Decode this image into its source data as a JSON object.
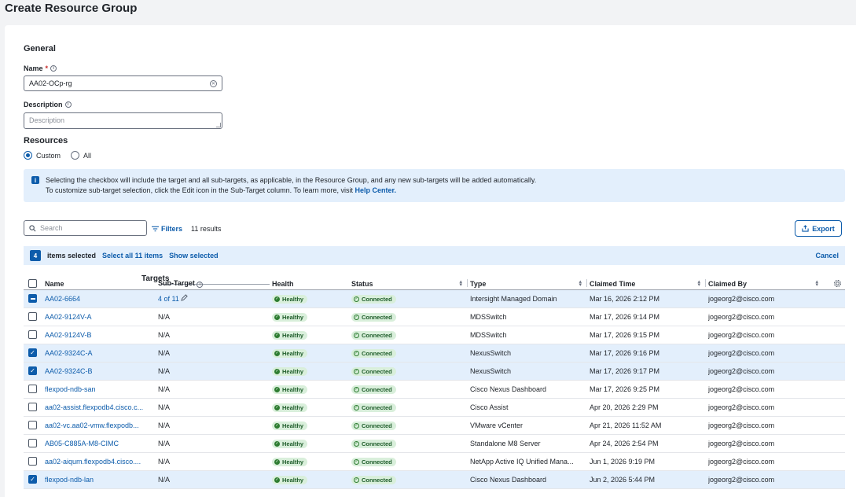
{
  "page_title": "Create Resource Group",
  "general": {
    "title": "General",
    "name_label": "Name",
    "name_required": "*",
    "name_value": "AA02-OCp-rg",
    "description_label": "Description",
    "description_placeholder": "Description"
  },
  "resources": {
    "title": "Resources",
    "options": [
      "Custom",
      "All"
    ],
    "selected": "Custom"
  },
  "banner": {
    "line1": "Selecting the checkbox will include the target and all sub-targets, as applicable, in the Resource Group, and any new sub-targets will be added automatically.",
    "line2": "To customize sub-target selection, click the Edit icon in the Sub-Target column. To learn more, visit ",
    "link": "Help Center."
  },
  "toolbar": {
    "search_placeholder": "Search",
    "filters_label": "Filters",
    "results": "11 results",
    "export_label": "Export"
  },
  "selection": {
    "count": "4",
    "items_selected": "items selected",
    "select_all": "Select all 11 items",
    "show_selected": "Show selected",
    "cancel": "Cancel"
  },
  "table": {
    "group_header": "Targets",
    "columns": {
      "name": "Name",
      "subtarget": "Sub-Target",
      "health": "Health",
      "status": "Status",
      "type": "Type",
      "claimed_time": "Claimed Time",
      "claimed_by": "Claimed By"
    },
    "rows": [
      {
        "state": "indeterminate",
        "name": "AA02-6664",
        "subtarget": "4 of 11",
        "health": "Healthy",
        "status": "Connected",
        "type": "Intersight Managed Domain",
        "claimed_time": "Mar 16, 2026 2:12 PM",
        "claimed_by": "jogeorg2@cisco.com"
      },
      {
        "state": "off",
        "name": "AA02-9124V-A",
        "subtarget": "N/A",
        "health": "Healthy",
        "status": "Connected",
        "type": "MDSSwitch",
        "claimed_time": "Mar 17, 2026 9:14 PM",
        "claimed_by": "jogeorg2@cisco.com"
      },
      {
        "state": "off",
        "name": "AA02-9124V-B",
        "subtarget": "N/A",
        "health": "Healthy",
        "status": "Connected",
        "type": "MDSSwitch",
        "claimed_time": "Mar 17, 2026 9:15 PM",
        "claimed_by": "jogeorg2@cisco.com"
      },
      {
        "state": "on",
        "name": "AA02-9324C-A",
        "subtarget": "N/A",
        "health": "Healthy",
        "status": "Connected",
        "type": "NexusSwitch",
        "claimed_time": "Mar 17, 2026 9:16 PM",
        "claimed_by": "jogeorg2@cisco.com"
      },
      {
        "state": "on",
        "name": "AA02-9324C-B",
        "subtarget": "N/A",
        "health": "Healthy",
        "status": "Connected",
        "type": "NexusSwitch",
        "claimed_time": "Mar 17, 2026 9:17 PM",
        "claimed_by": "jogeorg2@cisco.com"
      },
      {
        "state": "off",
        "name": "flexpod-ndb-san",
        "subtarget": "N/A",
        "health": "Healthy",
        "status": "Connected",
        "type": "Cisco Nexus Dashboard",
        "claimed_time": "Mar 17, 2026 9:25 PM",
        "claimed_by": "jogeorg2@cisco.com"
      },
      {
        "state": "off",
        "name": "aa02-assist.flexpodb4.cisco.c...",
        "subtarget": "N/A",
        "health": "Healthy",
        "status": "Connected",
        "type": "Cisco Assist",
        "claimed_time": "Apr 20, 2026 2:29 PM",
        "claimed_by": "jogeorg2@cisco.com"
      },
      {
        "state": "off",
        "name": "aa02-vc.aa02-vmw.flexpodb...",
        "subtarget": "N/A",
        "health": "Healthy",
        "status": "Connected",
        "type": "VMware vCenter",
        "claimed_time": "Apr 21, 2026 11:52 AM",
        "claimed_by": "jogeorg2@cisco.com"
      },
      {
        "state": "off",
        "name": "AB05-C885A-M8-CIMC",
        "subtarget": "N/A",
        "health": "Healthy",
        "status": "Connected",
        "type": "Standalone M8 Server",
        "claimed_time": "Apr 24, 2026 2:54 PM",
        "claimed_by": "jogeorg2@cisco.com"
      },
      {
        "state": "off",
        "name": "aa02-aiqum.flexpodb4.cisco....",
        "subtarget": "N/A",
        "health": "Healthy",
        "status": "Connected",
        "type": "NetApp Active IQ Unified Mana...",
        "claimed_time": "Jun 1, 2026 9:19 PM",
        "claimed_by": "jogeorg2@cisco.com"
      },
      {
        "state": "on",
        "name": "flexpod-ndb-lan",
        "subtarget": "N/A",
        "health": "Healthy",
        "status": "Connected",
        "type": "Cisco Nexus Dashboard",
        "claimed_time": "Jun 2, 2026 5:44 PM",
        "claimed_by": "jogeorg2@cisco.com"
      }
    ]
  },
  "colors": {
    "accent": "#0d5cab",
    "selected_row": "#e3effc",
    "healthy_bg": "#d9efdb",
    "healthy_fg": "#1e5c2a"
  }
}
